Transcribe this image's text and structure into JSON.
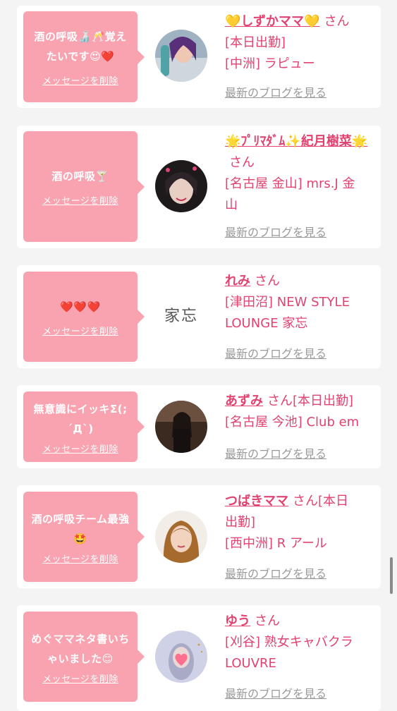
{
  "cards": [
    {
      "message": "酒の呼吸🍶🥂覚えたいです😍❤️",
      "delete_label": "メッセージを削除",
      "name": "💛しずかママ💛",
      "san": "さん",
      "shop_lines": [
        "[本日出勤]",
        "[中洲] ラピュー"
      ],
      "blog_label": "最新のブログを見る"
    },
    {
      "message": "酒の呼吸🍸",
      "delete_label": "メッセージを削除",
      "name": "🌟ﾌﾟﾘﾏﾀﾞﾑ✨紀月樹菜🌟",
      "san": "さん",
      "shop_lines": [
        "[名古屋 金山] mrs.J 金",
        "山"
      ],
      "blog_label": "最新のブログを見る"
    },
    {
      "message": "❤️❤️❤️",
      "delete_label": "メッセージを削除",
      "name": "れみ",
      "san": "さん",
      "shop_lines": [
        "[津田沼] NEW STYLE",
        "LOUNGE 家忘"
      ],
      "blog_label": "最新のブログを見る",
      "logo_text": "家忘"
    },
    {
      "message": "無意識にイッキΣ(;´Д`)",
      "delete_label": "メッセージを削除",
      "name": "あずみ",
      "san": "さん[本日出勤]",
      "shop_lines": [
        "[名古屋 今池] Club em"
      ],
      "blog_label": "最新のブログを見る"
    },
    {
      "message": "酒の呼吸チーム最強🤩",
      "delete_label": "メッセージを削除",
      "name": "つばきママ",
      "san": "さん[本日",
      "shop_lines": [
        "出勤]",
        "[西中洲] R アール"
      ],
      "blog_label": "最新のブログを見る"
    },
    {
      "message": "めぐママネタ書いちゃいました😊",
      "delete_label": "メッセージを削除",
      "name": "ゆう",
      "san": "さん",
      "shop_lines": [
        "[刈谷] 熟女キャバクラ",
        "LOUVRE"
      ],
      "blog_label": "最新のブログを見る"
    }
  ],
  "colors": {
    "bubble": "#f9a3b1",
    "accent": "#e2426f",
    "muted": "#9a9a9a"
  }
}
